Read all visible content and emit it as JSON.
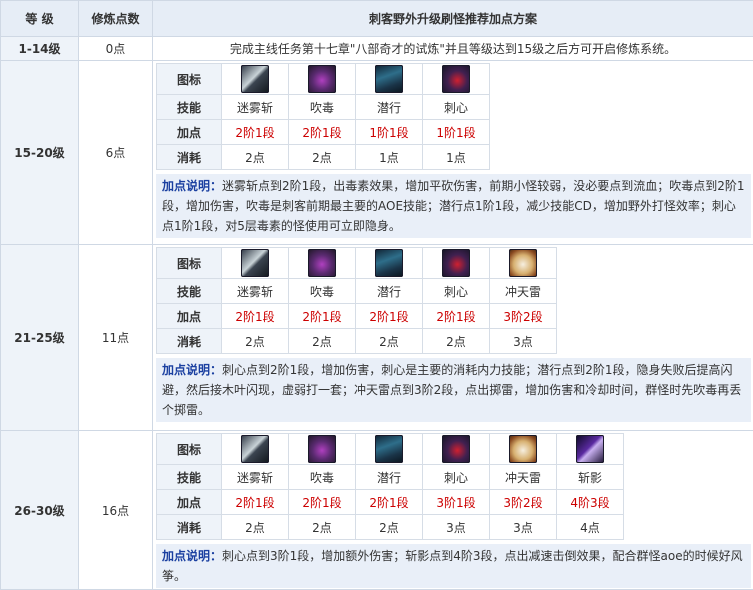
{
  "header": {
    "level": "等 级",
    "points": "修炼点数",
    "plan": "刺客野外升级刷怪推荐加点方案"
  },
  "row_1": {
    "level": "1-14级",
    "points": "0点",
    "text": "完成主线任务第十七章\"八部奇才的试炼\"并且等级达到15级之后方可开启修炼系统。"
  },
  "labels": {
    "icon": "图标",
    "skill": "技能",
    "add": "加点",
    "cost": "消耗",
    "note": "加点说明："
  },
  "row_2": {
    "level": "15-20级",
    "points": "6点",
    "skills": [
      {
        "name": "迷雾斩",
        "add": "2阶1段",
        "cost": "2点",
        "icon": "mist-slash-icon"
      },
      {
        "name": "吹毒",
        "add": "2阶1段",
        "cost": "2点",
        "icon": "poison-blow-icon"
      },
      {
        "name": "潜行",
        "add": "1阶1段",
        "cost": "1点",
        "icon": "stealth-icon"
      },
      {
        "name": "刺心",
        "add": "1阶1段",
        "cost": "1点",
        "icon": "heart-pierce-icon"
      }
    ],
    "note": "迷雾斩点到2阶1段，出毒素效果，增加平砍伤害，前期小怪较弱，没必要点到流血；吹毒点到2阶1段，增加伤害，吹毒是刺客前期最主要的AOE技能；潜行点1阶1段，减少技能CD，增加野外打怪效率；刺心点1阶1段，对5层毒素的怪使用可立即隐身。"
  },
  "row_3": {
    "level": "21-25级",
    "points": "11点",
    "skills": [
      {
        "name": "迷雾斩",
        "add": "2阶1段",
        "cost": "2点",
        "icon": "mist-slash-icon"
      },
      {
        "name": "吹毒",
        "add": "2阶1段",
        "cost": "2点",
        "icon": "poison-blow-icon"
      },
      {
        "name": "潜行",
        "add": "2阶1段",
        "cost": "2点",
        "icon": "stealth-icon"
      },
      {
        "name": "刺心",
        "add": "2阶1段",
        "cost": "2点",
        "icon": "heart-pierce-icon"
      },
      {
        "name": "冲天雷",
        "add": "3阶2段",
        "cost": "3点",
        "icon": "sky-thunder-icon"
      }
    ],
    "note": "刺心点到2阶1段，增加伤害，刺心是主要的消耗内力技能；潜行点到2阶1段，隐身失败后提高闪避，然后接木叶闪现，虚弱打一套；冲天雷点到3阶2段，点出掷雷，增加伤害和冷却时间，群怪时先吹毒再丢个掷雷。"
  },
  "row_4": {
    "level": "26-30级",
    "points": "16点",
    "skills": [
      {
        "name": "迷雾斩",
        "add": "2阶1段",
        "cost": "2点",
        "icon": "mist-slash-icon"
      },
      {
        "name": "吹毒",
        "add": "2阶1段",
        "cost": "2点",
        "icon": "poison-blow-icon"
      },
      {
        "name": "潜行",
        "add": "2阶1段",
        "cost": "2点",
        "icon": "stealth-icon"
      },
      {
        "name": "刺心",
        "add": "3阶1段",
        "cost": "3点",
        "icon": "heart-pierce-icon"
      },
      {
        "name": "冲天雷",
        "add": "3阶2段",
        "cost": "3点",
        "icon": "sky-thunder-icon"
      },
      {
        "name": "斩影",
        "add": "4阶3段",
        "cost": "4点",
        "icon": "shadow-slash-icon"
      }
    ],
    "note": "刺心点到3阶1段，增加额外伤害；斩影点到4阶3段，点出减速击倒效果，配合群怪aoe的时候好风筝。"
  },
  "colors": {
    "header_bg": "#e6edf6",
    "level_bg": "#eef3f9",
    "note_bg": "#e9eff8",
    "note_label": "#1a3fa0",
    "add_text": "#cc0000"
  }
}
